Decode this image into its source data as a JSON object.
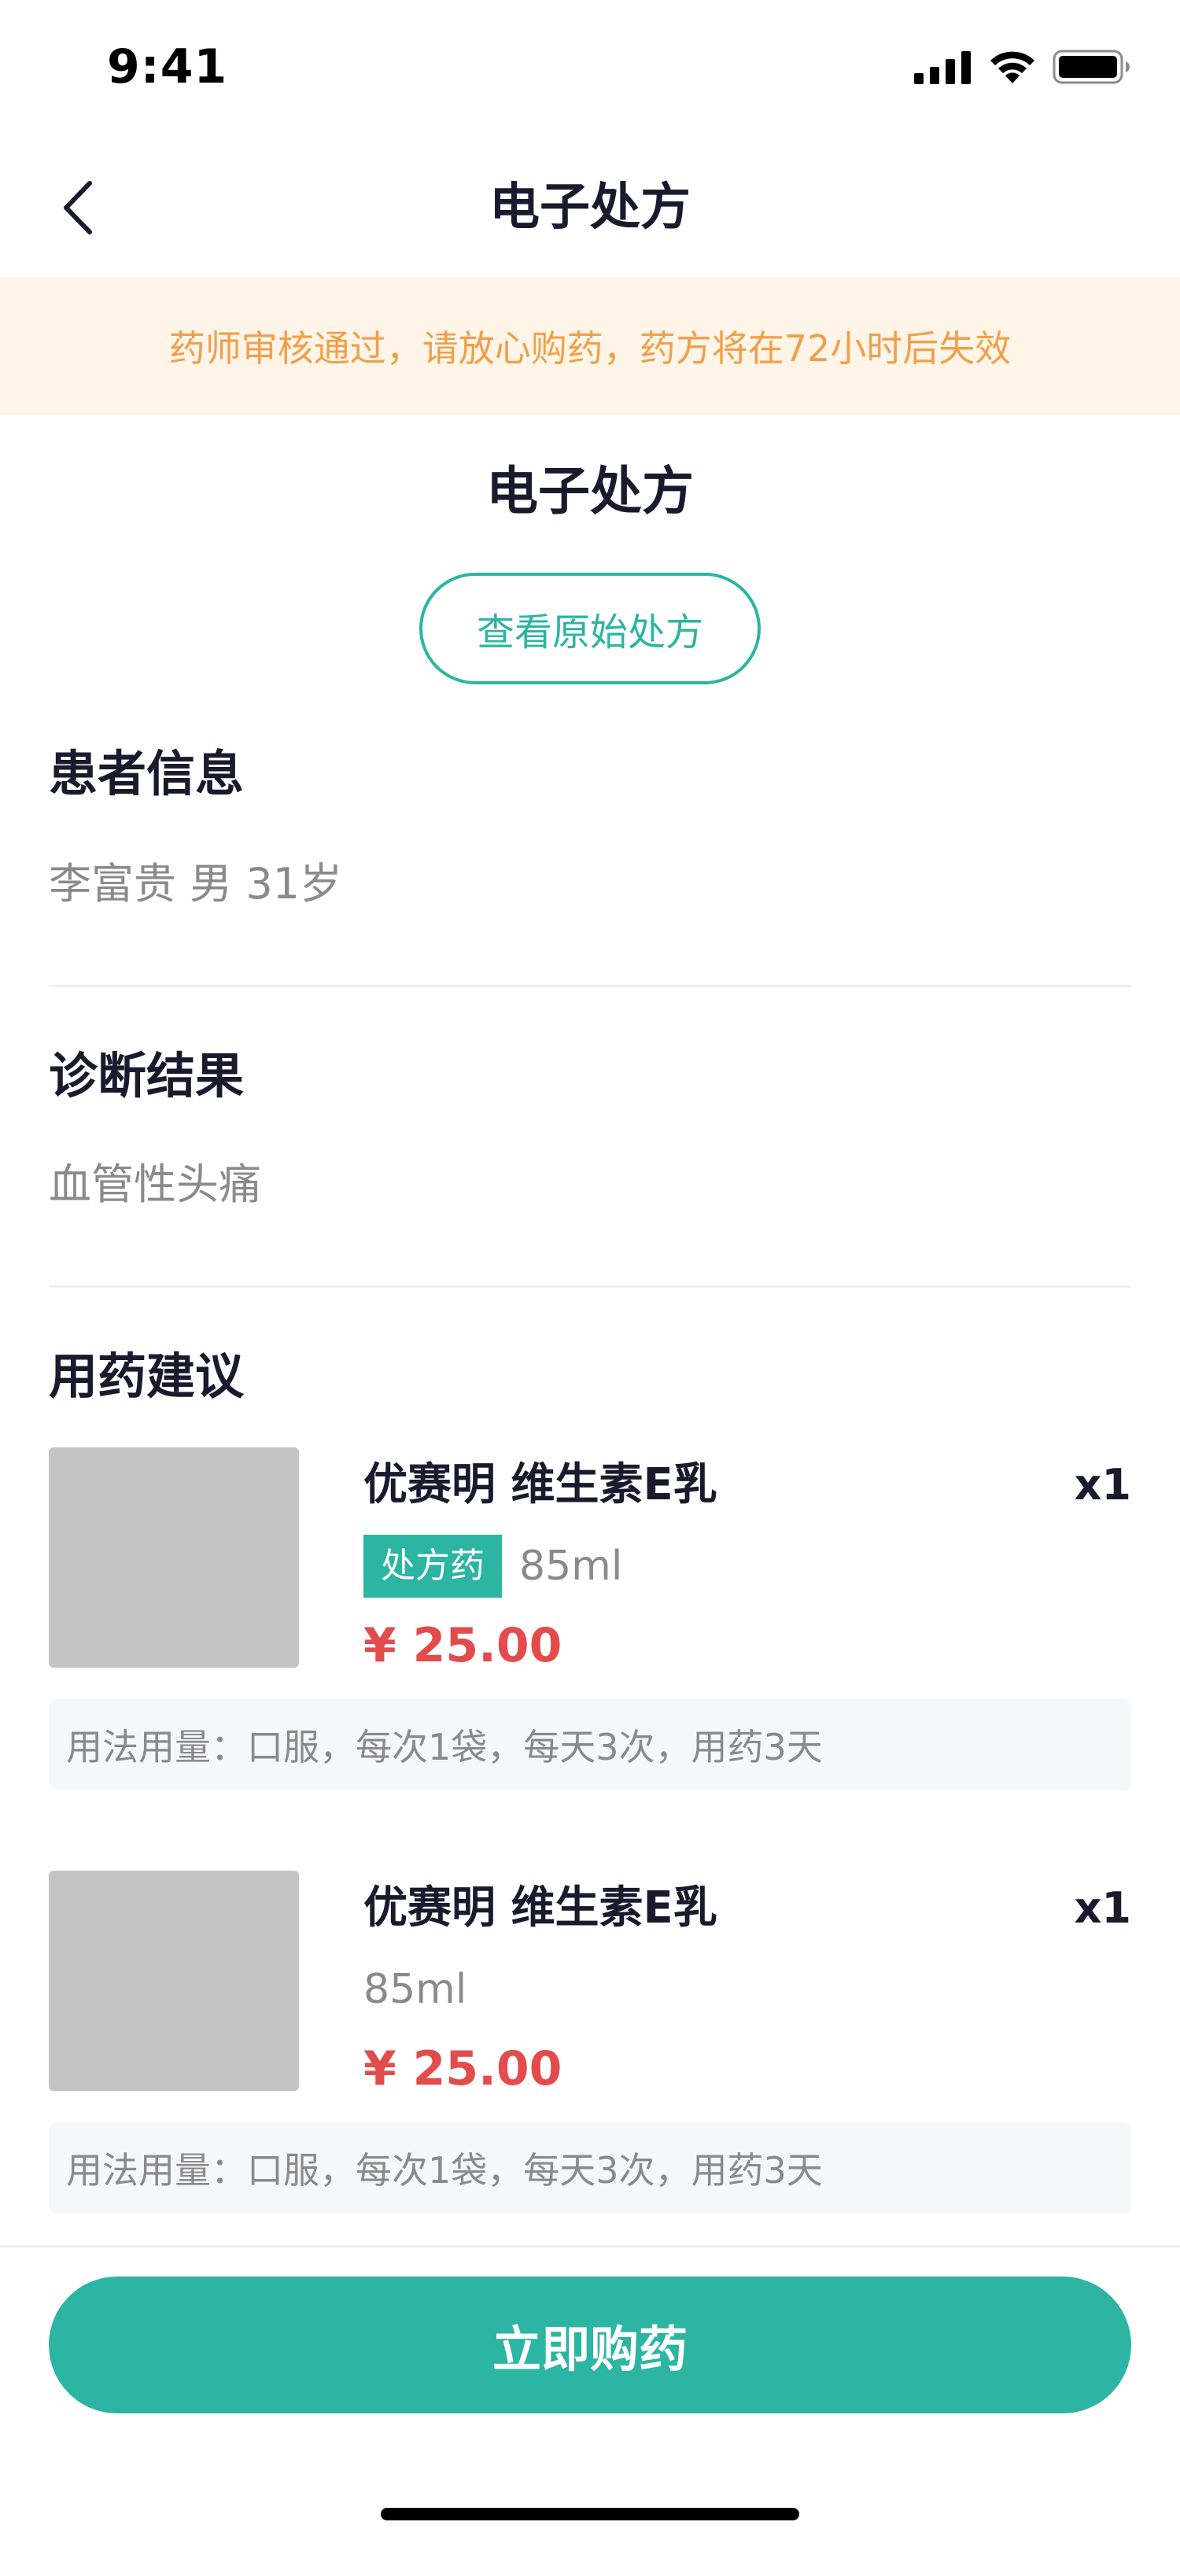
{
  "status_bar": {
    "time": "9:41"
  },
  "nav": {
    "title": "电子处方",
    "back_icon": "chevron-left-icon"
  },
  "notice": {
    "text": "药师审核通过，请放心购药，药方将在72小时后失效"
  },
  "prescription": {
    "title": "电子处方",
    "view_original_label": "查看原始处方"
  },
  "patient": {
    "heading": "患者信息",
    "value": "李富贵 男 31岁"
  },
  "diagnosis": {
    "heading": "诊断结果",
    "value": "血管性头痛"
  },
  "medication": {
    "heading": "用药建议",
    "items": [
      {
        "name": "优赛明 维生素E乳",
        "quantity": "x1",
        "tag": "处方药",
        "spec": "85ml",
        "price": "¥ 25.00",
        "usage": "用法用量：口服，每次1袋，每天3次，用药3天"
      },
      {
        "name": "优赛明 维生素E乳",
        "quantity": "x1",
        "tag": "",
        "spec": "85ml",
        "price": "¥ 25.00",
        "usage": "用法用量：口服，每次1袋，每天3次，用药3天"
      }
    ]
  },
  "footer": {
    "buy_label": "立即购药"
  },
  "colors": {
    "accent": "#2bb5a2",
    "price": "#e24c4c",
    "notice_bg": "#fef5e8",
    "notice_text": "#f0a04a"
  }
}
